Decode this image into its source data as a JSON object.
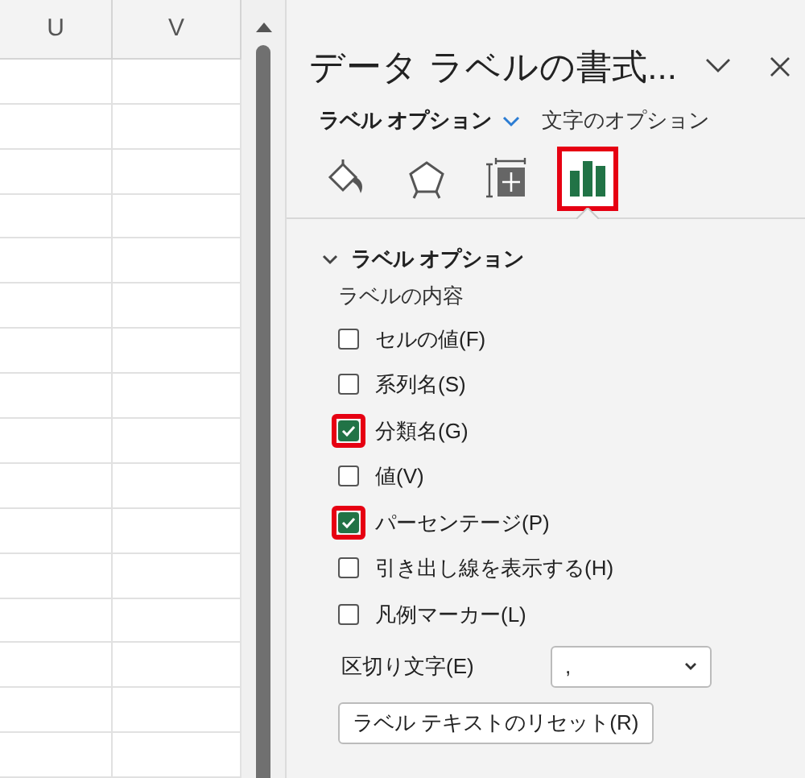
{
  "spreadsheet": {
    "columns": [
      "U",
      "V"
    ]
  },
  "panel": {
    "title": "データ ラベルの書式...",
    "tabs": [
      {
        "label": "ラベル オプション",
        "selected": true
      },
      {
        "label": "文字のオプション",
        "selected": false
      }
    ],
    "icon_tabs": [
      {
        "kind": "fill",
        "selected": false,
        "highlighted": false
      },
      {
        "kind": "effects",
        "selected": false,
        "highlighted": false
      },
      {
        "kind": "size",
        "selected": false,
        "highlighted": false
      },
      {
        "kind": "chart",
        "selected": true,
        "highlighted": true
      }
    ],
    "section": {
      "title": "ラベル オプション",
      "expanded": true,
      "group_label": "ラベルの内容",
      "options": [
        {
          "label": "セルの値(F)",
          "checked": false,
          "highlighted": false
        },
        {
          "label": "系列名(S)",
          "checked": false,
          "highlighted": false
        },
        {
          "label": "分類名(G)",
          "checked": true,
          "highlighted": true
        },
        {
          "label": "値(V)",
          "checked": false,
          "highlighted": false
        },
        {
          "label": "パーセンテージ(P)",
          "checked": true,
          "highlighted": true
        },
        {
          "label": "引き出し線を表示する(H)",
          "checked": false,
          "highlighted": false
        },
        {
          "label": "凡例マーカー(L)",
          "checked": false,
          "highlighted": false
        }
      ],
      "separator": {
        "label": "区切り文字(E)",
        "value": ","
      },
      "reset_button": "ラベル テキストのリセット(R)"
    }
  }
}
